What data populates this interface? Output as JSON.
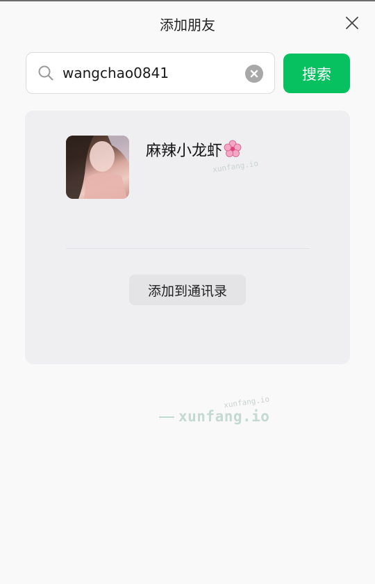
{
  "header": {
    "title": "添加朋友"
  },
  "search": {
    "value": "wangchao0841",
    "button_label": "搜索"
  },
  "result": {
    "nickname": "麻辣小龙虾",
    "add_button_label": "添加到通讯录"
  },
  "watermark": {
    "small_text": "xunfang.io",
    "main_text": "xunfang.io"
  },
  "colors": {
    "accent": "#07c160",
    "card_background": "#efeff2",
    "page_background": "#f9f9f9"
  },
  "icons": {
    "search": "search-icon",
    "clear": "clear-icon",
    "close": "close-icon",
    "emoji": "cherry-blossom-icon"
  }
}
